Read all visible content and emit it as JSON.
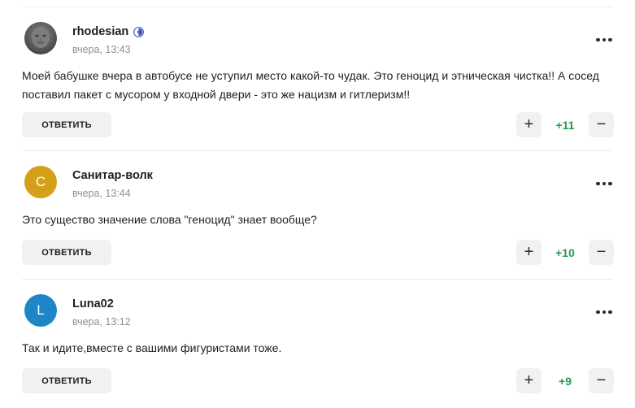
{
  "comments": [
    {
      "username": "rhodesian",
      "time": "вчера, 13:43",
      "avatar_type": "photo",
      "avatar_letter": "",
      "has_badge": true,
      "text": "Моей бабушке вчера в автобусе не уступил место какой-то чудак. Это геноцид и этническая чистка!! А сосед поставил пакет с мусором у входной двери - это же нацизм и гитлеризм!!",
      "reply_label": "ОТВЕТИТЬ",
      "score": "+11",
      "upvote_icon": "plus-icon",
      "downvote_icon": "minus-icon"
    },
    {
      "username": "Санитар-волк",
      "time": "вчера, 13:44",
      "avatar_type": "letter",
      "avatar_letter": "С",
      "avatar_color": "#d4a018",
      "has_badge": false,
      "text": "Это существо значение слова \"геноцид\" знает вообще?",
      "reply_label": "ОТВЕТИТЬ",
      "score": "+10",
      "upvote_icon": "plus-icon",
      "downvote_icon": "minus-icon"
    },
    {
      "username": "Luna02",
      "time": "вчера, 13:12",
      "avatar_type": "letter",
      "avatar_letter": "L",
      "avatar_color": "#1e86c7",
      "has_badge": false,
      "text": "Так и идите,вместе с вашими фигуристами тоже.",
      "reply_label": "ОТВЕТИТЬ",
      "score": "+9",
      "upvote_icon": "plus-icon",
      "downvote_icon": "minus-icon"
    }
  ],
  "colors": {
    "score": "#1d9e4f",
    "button_bg": "#f1f1f1",
    "time": "#8f8f8f"
  }
}
